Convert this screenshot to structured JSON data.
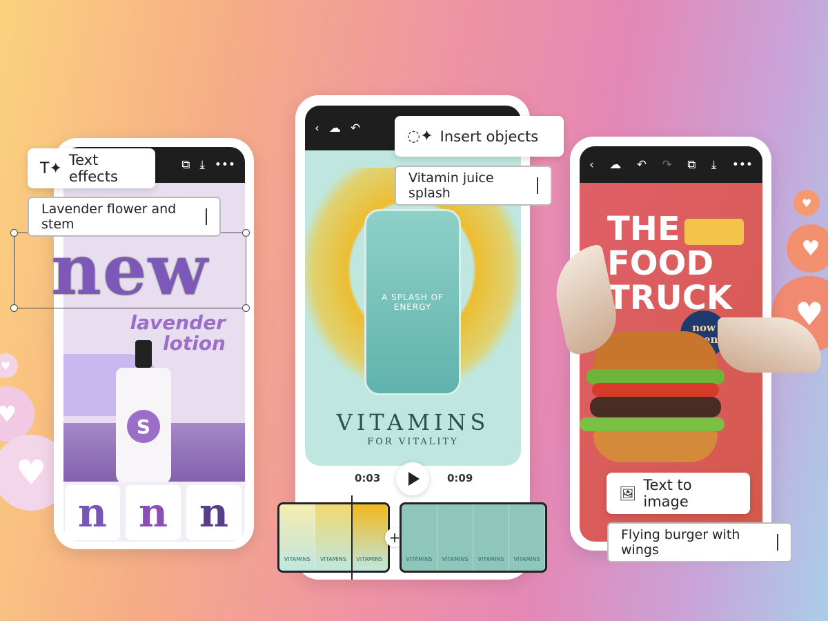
{
  "left_phone": {
    "chip_label": "Text effects",
    "prompt_value": "Lavender flower and stem",
    "headline": "new",
    "subhead_line1": "lavender",
    "subhead_line2": "lotion",
    "bottle_logo": "S",
    "style_tiles": [
      "n",
      "n",
      "n"
    ],
    "header_icons": [
      "pages-icon",
      "download-icon",
      "more-icon"
    ]
  },
  "center_phone": {
    "chip_label": "Insert objects",
    "prompt_value": "Vitamin juice splash",
    "jar_text": "A SPLASH OF ENERGY",
    "title": "VITAMINS",
    "subtitle": "FOR VITALITY",
    "time_current": "0:03",
    "time_total": "0:09",
    "add_clip": "+",
    "clip_label": "VITAMINS"
  },
  "right_phone": {
    "chip_label": "Text to image",
    "prompt_value": "Flying burger with wings",
    "title_lines": [
      "THE",
      "FOOD",
      "TRUCK"
    ],
    "badge_line1": "now",
    "badge_line2": "open",
    "header_icons": [
      "back-icon",
      "cloud-icon",
      "undo-icon",
      "redo-icon",
      "pages-icon",
      "download-icon",
      "more-icon"
    ]
  },
  "colors": {
    "lavender": "#9b6fc8",
    "mint": "#bfe7df",
    "truck_red": "#d95a50",
    "badge_blue": "#1f3a6e",
    "juice": "#f2b81e"
  }
}
